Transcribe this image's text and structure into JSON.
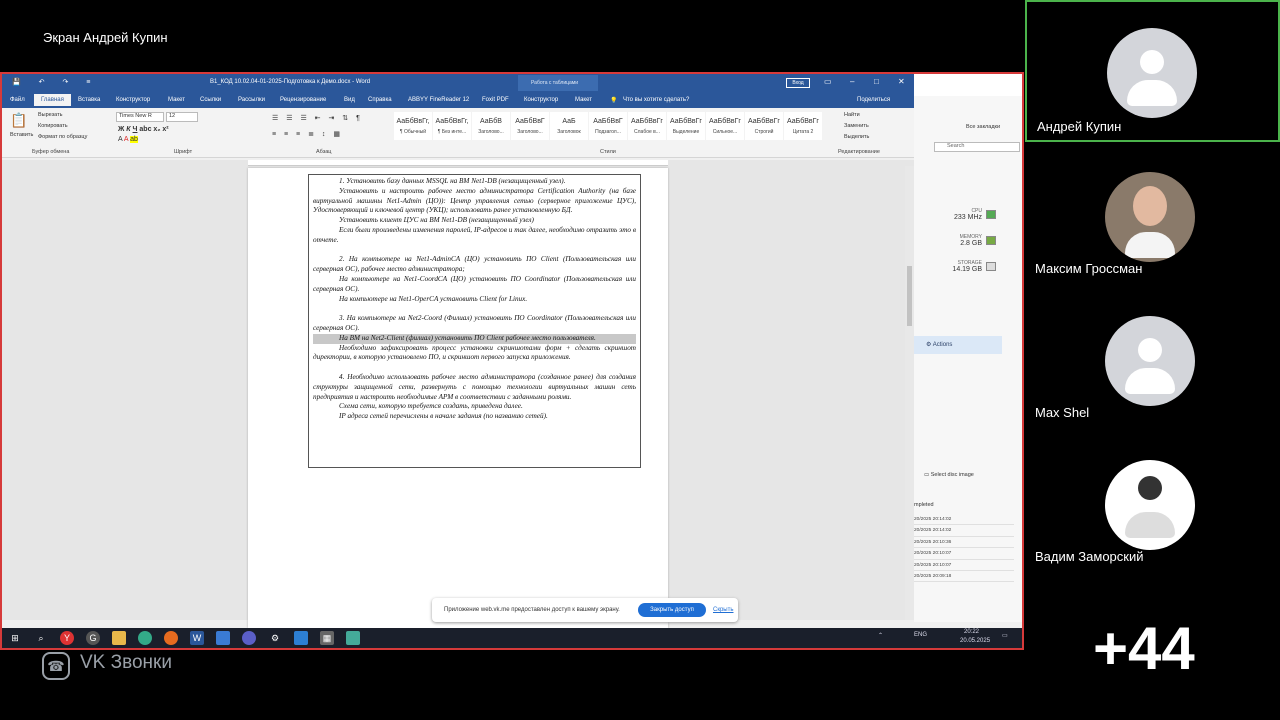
{
  "call": {
    "screen_title": "Экран Андрей Купин",
    "app_name": "VK Звонки",
    "more_participants": "+44",
    "participants": [
      {
        "name": "Андрей Купин"
      },
      {
        "name": "Максим Гроссман"
      },
      {
        "name": "Max Shel"
      },
      {
        "name": "Вадим Заморский"
      }
    ]
  },
  "word": {
    "doc_title": "В1_КОД 10.02.04-01-2025-Подготовка к Демо.docx - Word",
    "context_tab": "Работа с таблицами",
    "signin": "Вход",
    "tabs": [
      "Файл",
      "Главная",
      "Вставка",
      "Конструктор",
      "Макет",
      "Ссылки",
      "Рассылки",
      "Рецензирование",
      "Вид",
      "Справка",
      "ABBYY FineReader 12",
      "Foxit PDF",
      "Конструктор",
      "Макет"
    ],
    "tell_me": "Что вы хотите сделать?",
    "share": "Поделиться",
    "clipboard": {
      "paste": "Вставить",
      "cut": "Вырезать",
      "copy": "Копировать",
      "format_painter": "Формат по образцу",
      "group": "Буфер обмена"
    },
    "font": {
      "name": "Times New R",
      "size": "12",
      "group": "Шрифт"
    },
    "paragraph_group": "Абзац",
    "styles": [
      {
        "preview": "АаБбВвГг,",
        "name": "¶ Обычный"
      },
      {
        "preview": "АаБбВвГг,",
        "name": "¶ Без инте..."
      },
      {
        "preview": "АаБбВ",
        "name": "Заголово..."
      },
      {
        "preview": "АаБбВвГ",
        "name": "Заголово..."
      },
      {
        "preview": "AaБ",
        "name": "Заголовок"
      },
      {
        "preview": "АаБбВвГ",
        "name": "Подзагол..."
      },
      {
        "preview": "АаБбВвГг",
        "name": "Слабое в..."
      },
      {
        "preview": "АаБбВвГг",
        "name": "Выделение"
      },
      {
        "preview": "АаБбВвГг",
        "name": "Сильное..."
      },
      {
        "preview": "АаБбВвГг",
        "name": "Строгий"
      },
      {
        "preview": "АаБбВвГг",
        "name": "Цитата 2"
      }
    ],
    "styles_group": "Стили",
    "editing": {
      "find": "Найти",
      "replace": "Заменить",
      "select": "Выделить",
      "group": "Редактирование"
    },
    "paragraphs": [
      "1. Установить базу данных MSSQL на ВМ Net1-DB (незащищенный узел).",
      "Установить и настроить рабочее место администратора Certification Authority (на базе виртуальной машины Net1-Admin (ЦО)): Центр управления сетью (серверное приложение ЦУС), Удостоверяющий и ключевой центр (УКЦ); использовать ранее установленную БД.",
      "Установить клиент ЦУС на ВМ Net1-DB (незащищенный узел)",
      "Если были произведены изменения паролей, IP-адресов и так далее, необходимо отразить это в отчете.",
      "",
      "2. На компьютере на Net1-AdminCA (ЦО) установить ПО Client (Пользовательская или серверная ОС), рабочее место администратора;",
      "На компьютере на Net1-CoordCA (ЦО) установить ПО Coordinator (Пользовательская или серверная ОС).",
      "На компьютере на Net1-OperCA установить Client for Linux.",
      "",
      "3. На компьютере на Net2-Coord (Филиал) установить ПО Coordinator (Пользовательская или серверная ОС).",
      "На ВМ на Net2-Client (филиал) установить ПО Client рабочее место пользователя.",
      "Необходимо зафиксировать процесс установки скриншотами форм + сделать скриншот директории, в которую установлено ПО, и скриншот первого запуска приложения.",
      "",
      "4. Необходимо использовать рабочее место администратора (созданное ранее) для создания структуры защищенной сети, развернуть с помощью технологии виртуальных машин сеть предприятия и настроить необходимые АРМ в соответствии с заданными ролями.",
      "Схема сети, которую требуется создать, приведена далее.",
      "IP адреса сетей перечислены в начале задания (по названию сетей)."
    ]
  },
  "bg_window": {
    "bookmarks": "Все закладки",
    "search": "Search",
    "cpu_label": "CPU",
    "cpu_value": "233 MHz",
    "memory_label": "MEMORY",
    "memory_value": "2.8 GB",
    "storage_label": "STORAGE",
    "storage_value": "14.19 GB",
    "actions": "Actions",
    "select_disc": "Select disc image",
    "completed": "mpleted",
    "log_rows": [
      "20/2025 20:14:02",
      "20/2025 20:14:02",
      "20/2025 20:10:36",
      "20/2025 20:10:07",
      "20/2025 20:10:07",
      "20/2025 20:09:18"
    ]
  },
  "notification": {
    "message": "Приложение web.vk.me предоставлен доступ к вашему экрану.",
    "stop_button": "Закрыть доступ",
    "hide": "Скрыть"
  },
  "taskbar": {
    "lang": "ENG",
    "time": "20:22",
    "date": "20.05.2025"
  }
}
